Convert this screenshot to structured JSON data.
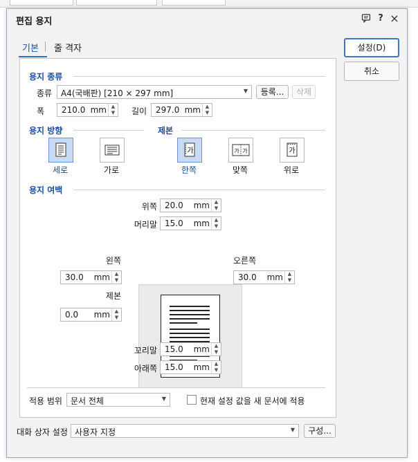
{
  "dialog": {
    "title": "편집 용지",
    "help_glyph": "?",
    "close_glyph": "×"
  },
  "tabs": [
    {
      "label": "기본",
      "active": true
    },
    {
      "label": "줄 격자",
      "active": false
    }
  ],
  "paper_type": {
    "section_title": "용지 종류",
    "kind_label": "종류",
    "kind_value": "A4(국배판) [210 × 297 mm]",
    "register_label": "등록...",
    "delete_label": "삭제",
    "width_label": "폭",
    "width_value": "210.0",
    "height_label": "길이",
    "height_value": "297.0",
    "unit": "mm"
  },
  "orientation": {
    "section_title": "용지 방향",
    "portrait_label": "세로",
    "landscape_label": "가로",
    "selected": "세로"
  },
  "binding": {
    "section_title": "제본",
    "single_label": "한쪽",
    "facing_label": "맞쪽",
    "top_label": "위로",
    "selected": "한쪽",
    "glyph": "가"
  },
  "margins": {
    "section_title": "용지 여백",
    "top_label": "위쪽",
    "top_value": "20.0",
    "header_label": "머리말",
    "header_value": "15.0",
    "left_label": "왼쪽",
    "left_value": "30.0",
    "right_label": "오른쪽",
    "right_value": "30.0",
    "binding_label": "제본",
    "binding_value": "0.0",
    "footer_label": "꼬리말",
    "footer_value": "15.0",
    "bottom_label": "아래쪽",
    "bottom_value": "15.0",
    "unit": "mm"
  },
  "apply": {
    "label": "적용 범위",
    "value": "문서 전체",
    "checkbox_label": "현재 설정 값을 새 문서에 적용",
    "checked": false
  },
  "dialog_settings": {
    "label": "대화 상자 설정",
    "value": "사용자 지정",
    "config_label": "구성..."
  },
  "buttons": {
    "ok_label": "설정(D)",
    "cancel_label": "취소"
  },
  "colors": {
    "accent": "#2d6bc8",
    "section_title": "#1a4e9c",
    "selected_bg": "#c9daf5"
  }
}
